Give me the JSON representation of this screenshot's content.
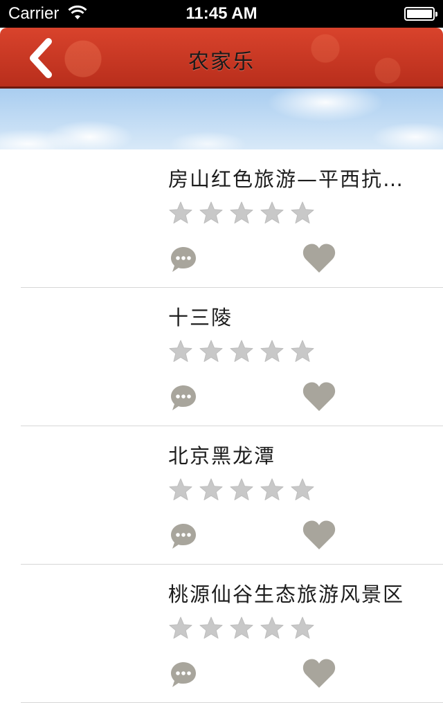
{
  "status_bar": {
    "carrier": "Carrier",
    "time": "11:45 AM"
  },
  "nav": {
    "title": "农家乐",
    "back_icon": "chevron-left-icon"
  },
  "colors": {
    "nav_red": "#c8371f",
    "star_gray": "#c8c8c8",
    "heart_gray": "#a8a59c",
    "comment_gray": "#a8a59c"
  },
  "items": [
    {
      "title": "房山红色旅游—平西抗…",
      "rating": 0,
      "max_rating": 5
    },
    {
      "title": "十三陵",
      "rating": 0,
      "max_rating": 5
    },
    {
      "title": "北京黑龙潭",
      "rating": 0,
      "max_rating": 5
    },
    {
      "title": "桃源仙谷生态旅游风景区",
      "rating": 0,
      "max_rating": 5
    }
  ]
}
